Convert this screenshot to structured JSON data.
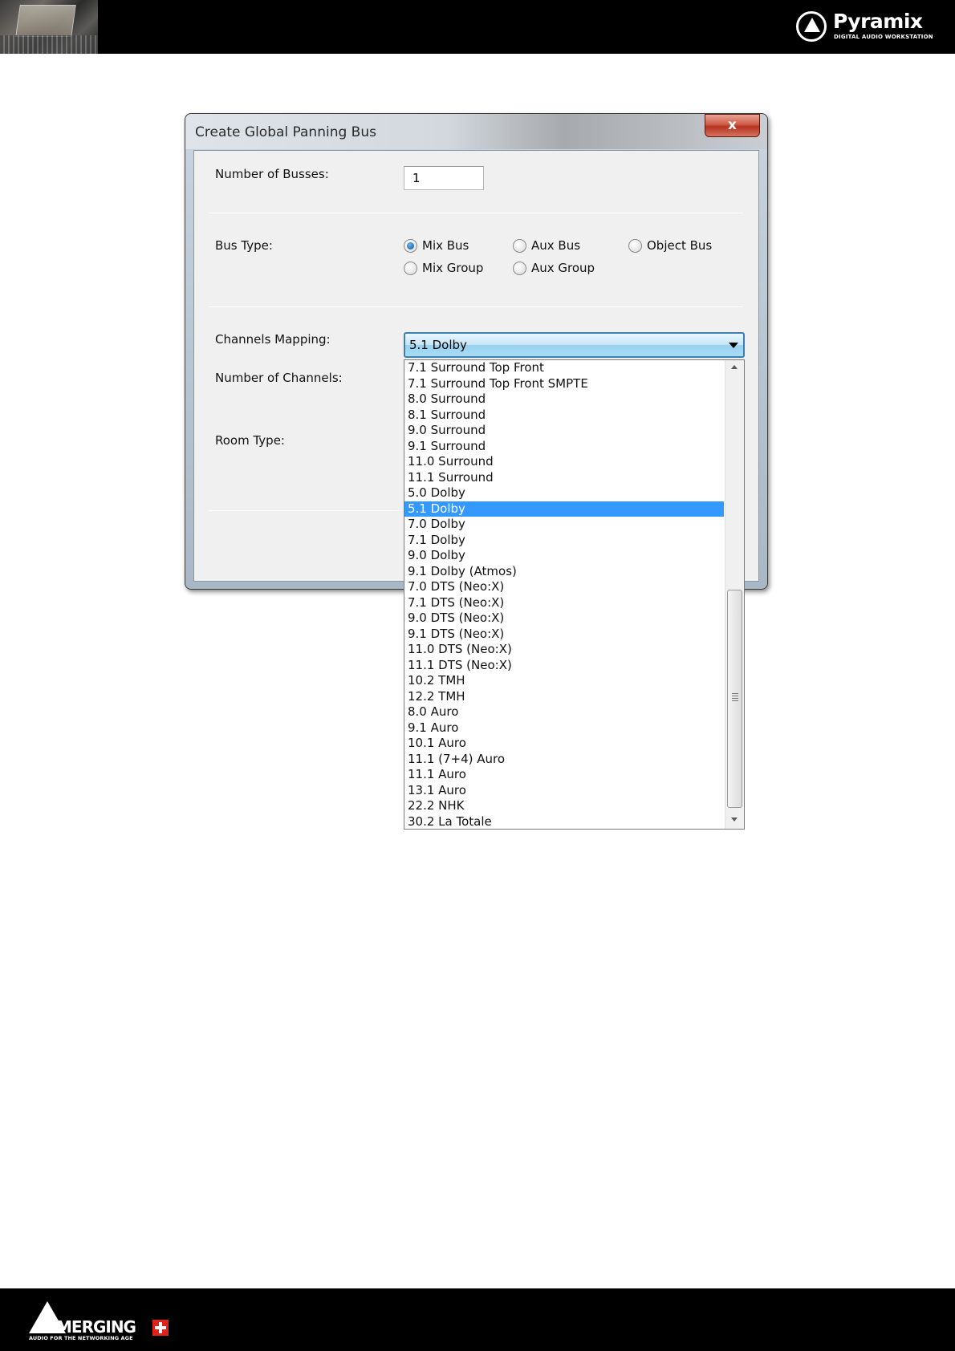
{
  "brand": {
    "name": "Pyramix",
    "tagline": "DIGITAL AUDIO WORKSTATION",
    "footer_name": "MERGING",
    "footer_tagline": "AUDIO FOR THE NETWORKING AGE"
  },
  "dialog": {
    "title": "Create Global Panning Bus",
    "close_label": "x",
    "busses_label": "Number of Busses:",
    "busses_value": "1",
    "bus_type_label": "Bus Type:",
    "bus_types": [
      {
        "label": "Mix Bus",
        "checked": true
      },
      {
        "label": "Aux Bus",
        "checked": false
      },
      {
        "label": "Object Bus",
        "checked": false
      },
      {
        "label": "Mix Group",
        "checked": false
      },
      {
        "label": "Aux Group",
        "checked": false
      }
    ],
    "channels_mapping_label": "Channels Mapping:",
    "channels_mapping_value": "5.1 Dolby",
    "num_channels_label": "Number of Channels:",
    "room_type_label": "Room Type:"
  },
  "dropdown": {
    "items": [
      "7.1 Surround Top Front",
      "7.1 Surround Top Front SMPTE",
      "8.0 Surround",
      "8.1 Surround",
      "9.0 Surround",
      "9.1 Surround",
      "11.0 Surround",
      "11.1 Surround",
      "5.0 Dolby",
      "5.1 Dolby",
      "7.0 Dolby",
      "7.1 Dolby",
      "9.0 Dolby",
      "9.1 Dolby (Atmos)",
      "7.0 DTS (Neo:X)",
      "7.1 DTS (Neo:X)",
      "9.0 DTS (Neo:X)",
      "9.1 DTS (Neo:X)",
      "11.0 DTS (Neo:X)",
      "11.1 DTS (Neo:X)",
      "10.2 TMH",
      "12.2 TMH",
      "8.0 Auro",
      "9.1 Auro",
      "10.1 Auro",
      "11.1 (7+4) Auro",
      "11.1 Auro",
      "13.1 Auro",
      "22.2 NHK",
      "30.2 La Totale"
    ],
    "selected_index": 9
  },
  "colors": {
    "selection": "#3399ff",
    "close_button": "#c8432f",
    "combo_border": "#3c7fb1"
  }
}
